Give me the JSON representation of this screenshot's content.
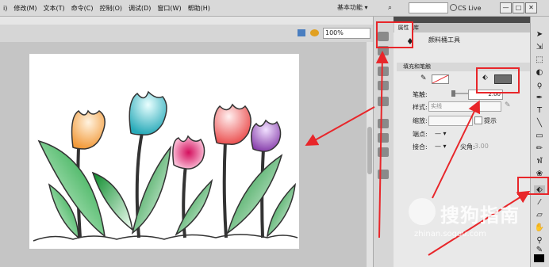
{
  "menu": [
    "ⅰ)",
    "修改(M)",
    "文本(T)",
    "命令(C)",
    "控制(O)",
    "调试(D)",
    "窗口(W)",
    "帮助(H)"
  ],
  "workspace": "基本功能 ▾",
  "search": "",
  "cslive": "CS Live",
  "window_buttons": [
    "—",
    "□",
    "✕"
  ],
  "zoom": "100%",
  "panel": {
    "tabs": [
      "属性",
      "库"
    ],
    "tool_name": "颜料桶工具",
    "section": "填充和笔触",
    "stroke_label": "笔触:",
    "stroke_value": "2.00",
    "style_label": "样式:",
    "style_value": "实线",
    "scale_label": "缩放:",
    "hint_label": "提示",
    "cap_label": "端点:",
    "join_label": "接合:",
    "miter_label": "尖角:",
    "miter_value": "3.00"
  },
  "watermark": {
    "text": "搜狗指南",
    "url": "zhinan.sogou.com"
  },
  "colors": {
    "fill": "#6d6d6d",
    "highlight": "#e8262a"
  }
}
